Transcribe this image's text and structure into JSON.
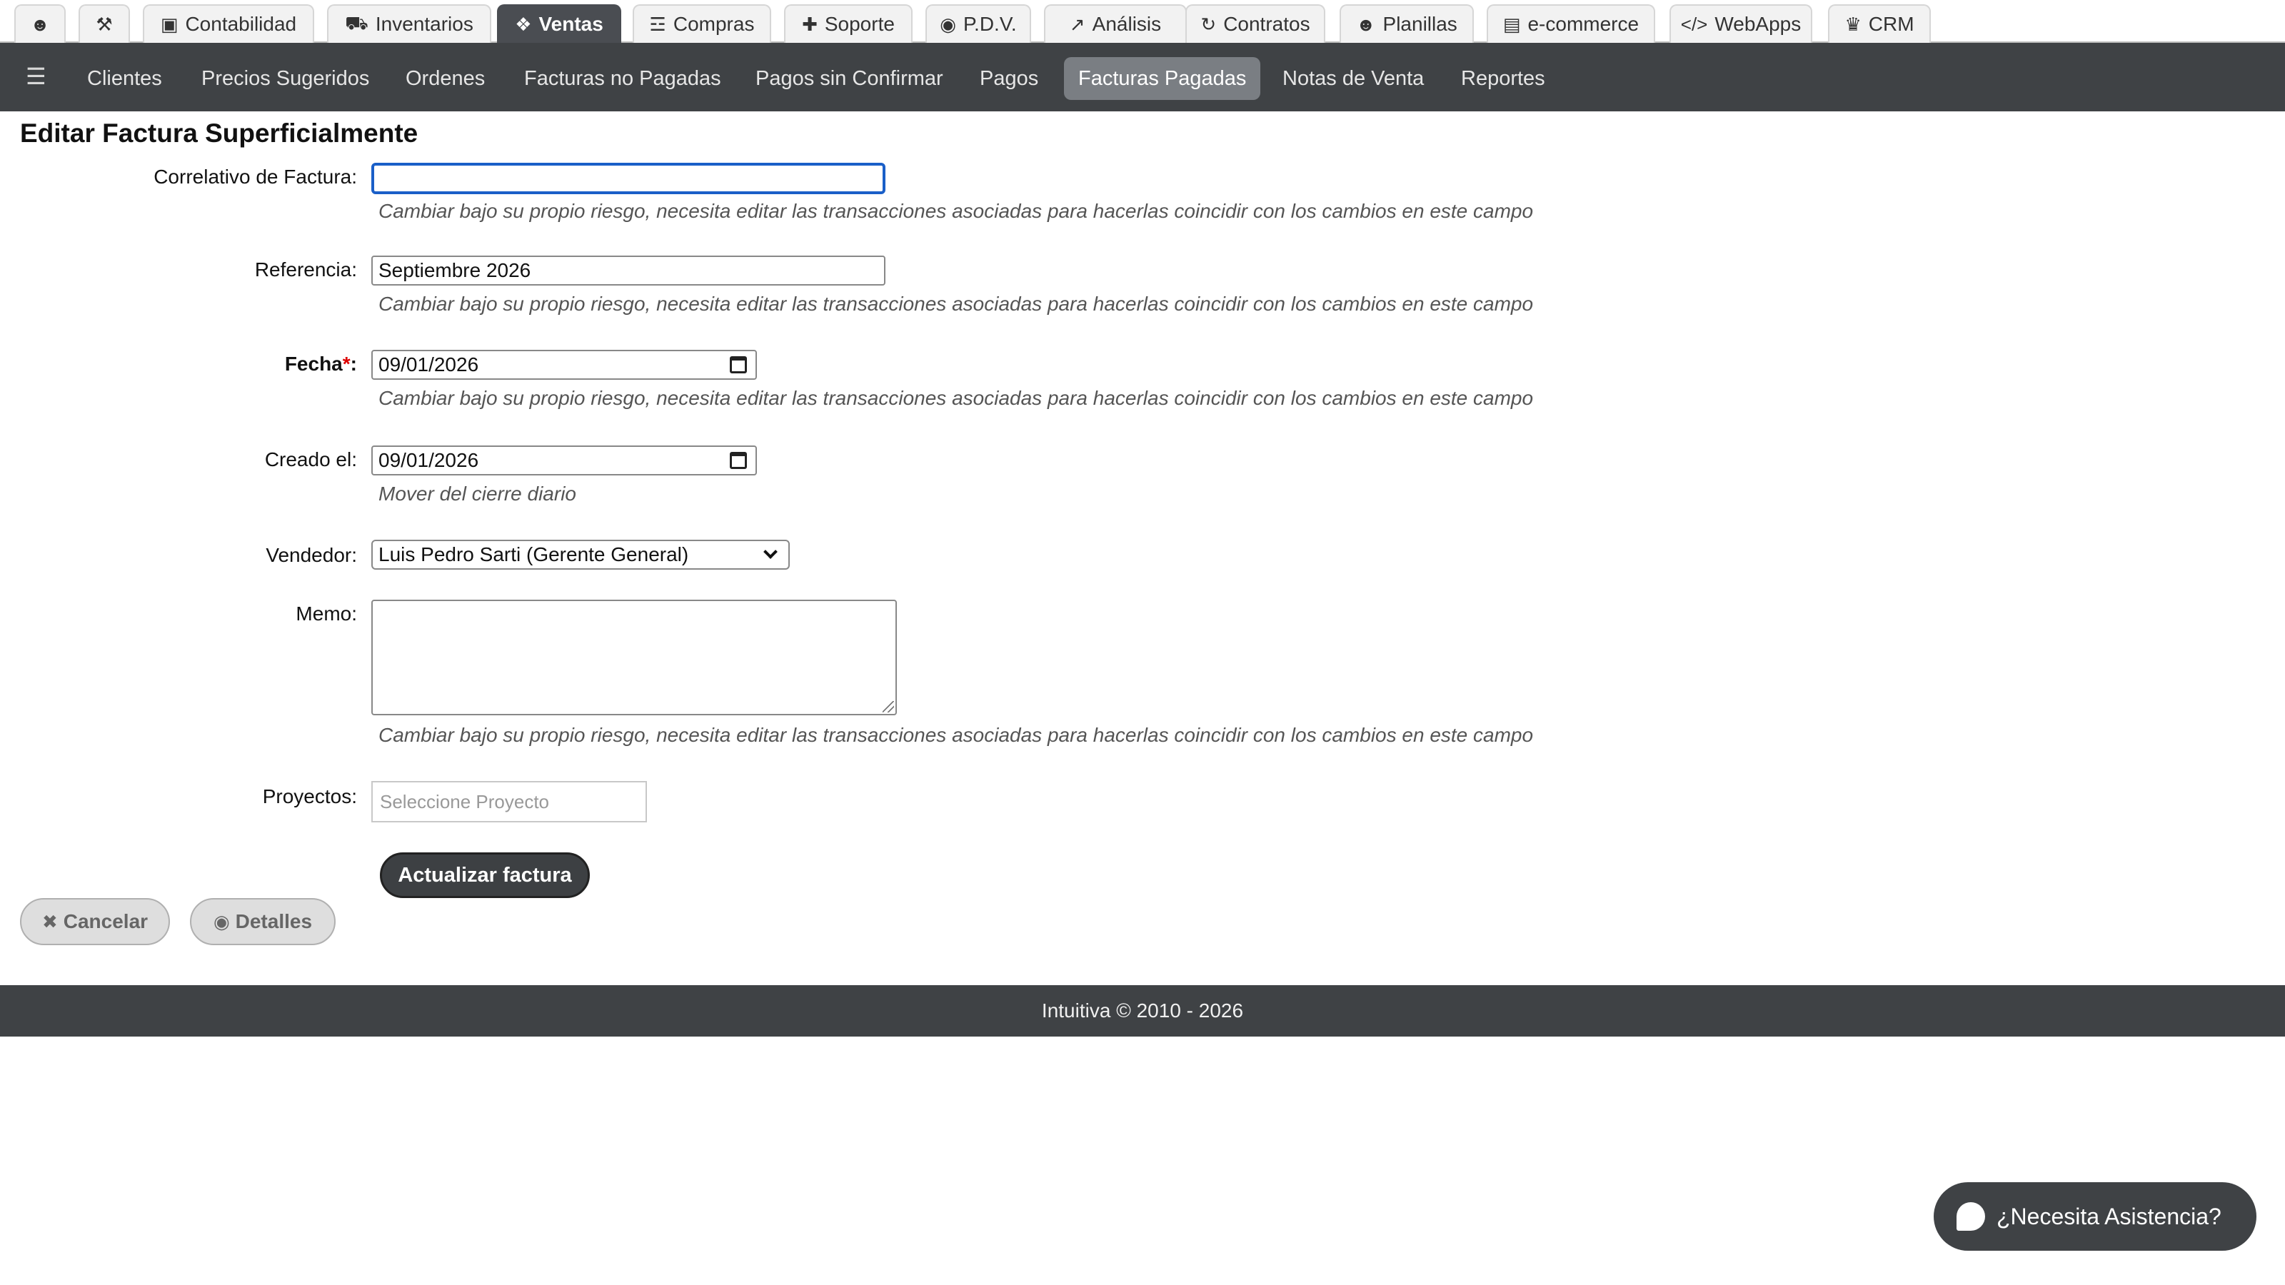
{
  "top_tabs": [
    {
      "label": "",
      "icon": "users-icon"
    },
    {
      "label": "",
      "icon": "wrench-icon"
    },
    {
      "label": "Contabilidad",
      "icon": "money-icon"
    },
    {
      "label": "Inventarios",
      "icon": "truck-icon"
    },
    {
      "label": "Ventas",
      "icon": "tags-icon",
      "active": true
    },
    {
      "label": "Compras",
      "icon": "cart-icon"
    },
    {
      "label": "Soporte",
      "icon": "medkit-icon"
    },
    {
      "label": "P.D.V.",
      "icon": "target-icon"
    },
    {
      "label": "Análisis",
      "icon": "line-chart-icon"
    },
    {
      "label": "Contratos",
      "icon": "refresh-icon"
    },
    {
      "label": "Planillas",
      "icon": "group-icon"
    },
    {
      "label": "e-commerce",
      "icon": "credit-card-icon"
    },
    {
      "label": "WebApps",
      "icon": "code-icon"
    },
    {
      "label": "CRM",
      "icon": "trophy-icon"
    }
  ],
  "subnav": {
    "items": [
      {
        "label": "Clientes"
      },
      {
        "label": "Precios Sugeridos"
      },
      {
        "label": "Ordenes"
      },
      {
        "label": "Facturas no Pagadas"
      },
      {
        "label": "Pagos sin Confirmar"
      },
      {
        "label": "Pagos"
      },
      {
        "label": "Facturas Pagadas",
        "active": true
      },
      {
        "label": "Notas de Venta"
      },
      {
        "label": "Reportes"
      }
    ]
  },
  "page": {
    "title": "Editar Factura Superficialmente"
  },
  "form": {
    "correlativo": {
      "label": "Correlativo de Factura:",
      "value": "",
      "help": "Cambiar bajo su propio riesgo, necesita editar las transacciones asociadas para hacerlas coincidir con los cambios en este campo"
    },
    "referencia": {
      "label": "Referencia:",
      "value": "Septiembre 2026",
      "help": "Cambiar bajo su propio riesgo, necesita editar las transacciones asociadas para hacerlas coincidir con los cambios en este campo"
    },
    "fecha": {
      "label": "Fecha",
      "required_mark": "*",
      "colon": ":",
      "value": "09/01/2026",
      "help": "Cambiar bajo su propio riesgo, necesita editar las transacciones asociadas para hacerlas coincidir con los cambios en este campo"
    },
    "creado": {
      "label": "Creado el:",
      "value": "09/01/2026",
      "help": "Mover del cierre diario"
    },
    "vendedor": {
      "label": "Vendedor:",
      "value": "Luis Pedro Sarti (Gerente General)"
    },
    "memo": {
      "label": "Memo:",
      "value": "",
      "help": "Cambiar bajo su propio riesgo, necesita editar las transacciones asociadas para hacerlas coincidir con los cambios en este campo"
    },
    "proyectos": {
      "label": "Proyectos:",
      "placeholder": "Seleccione Proyecto"
    },
    "submit_label": "Actualizar factura"
  },
  "actions": {
    "cancel_label": "Cancelar",
    "details_label": "Detalles"
  },
  "footer": {
    "text": "Intuitiva © 2010 - 2026"
  },
  "assist": {
    "label": "¿Necesita Asistencia?"
  }
}
